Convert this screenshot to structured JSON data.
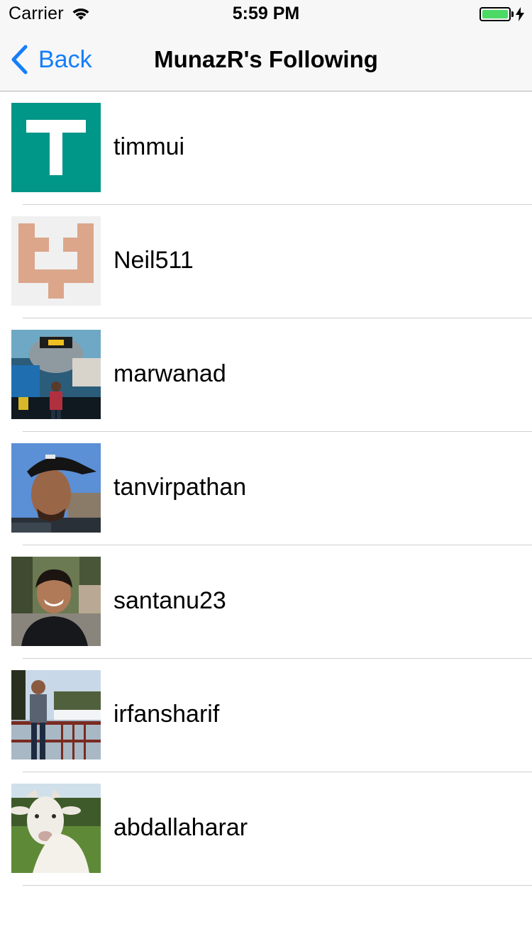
{
  "status_bar": {
    "carrier": "Carrier",
    "time": "5:59 PM",
    "battery_color": "#4cd964"
  },
  "nav": {
    "back_label": "Back",
    "title": "MunazR's Following",
    "tint": "#157efb"
  },
  "users": [
    {
      "username": "timmui",
      "avatar": "identicon-t"
    },
    {
      "username": "Neil511",
      "avatar": "identicon-pattern"
    },
    {
      "username": "marwanad",
      "avatar": "photo"
    },
    {
      "username": "tanvirpathan",
      "avatar": "photo"
    },
    {
      "username": "santanu23",
      "avatar": "photo"
    },
    {
      "username": "irfansharif",
      "avatar": "photo"
    },
    {
      "username": "abdallaharar",
      "avatar": "photo"
    }
  ]
}
